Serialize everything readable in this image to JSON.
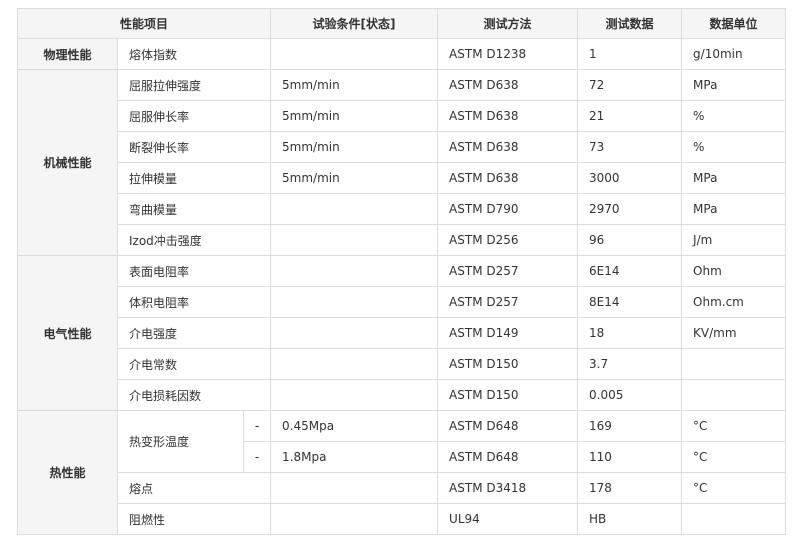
{
  "headers": [
    "性能项目",
    "试验条件[状态]",
    "测试方法",
    "测试数据",
    "数据单位"
  ],
  "groups": [
    {
      "category": "物理性能",
      "rows": [
        {
          "item": "熔体指数",
          "cond": "",
          "method": "ASTM D1238",
          "value": "1",
          "unit": "g/10min"
        }
      ]
    },
    {
      "category": "机械性能",
      "rows": [
        {
          "item": "屈服拉伸强度",
          "cond": "5mm/min",
          "method": "ASTM D638",
          "value": "72",
          "unit": "MPa"
        },
        {
          "item": "屈服伸长率",
          "cond": "5mm/min",
          "method": "ASTM D638",
          "value": "21",
          "unit": "%"
        },
        {
          "item": "断裂伸长率",
          "cond": "5mm/min",
          "method": "ASTM D638",
          "value": "73",
          "unit": "%"
        },
        {
          "item": "拉伸模量",
          "cond": "5mm/min",
          "method": "ASTM D638",
          "value": "3000",
          "unit": "MPa"
        },
        {
          "item": "弯曲模量",
          "cond": "",
          "method": "ASTM D790",
          "value": "2970",
          "unit": "MPa"
        },
        {
          "item": "Izod冲击强度",
          "cond": "",
          "method": "ASTM D256",
          "value": "96",
          "unit": "J/m"
        }
      ]
    },
    {
      "category": "电气性能",
      "rows": [
        {
          "item": "表面电阻率",
          "cond": "",
          "method": "ASTM D257",
          "value": "6E14",
          "unit": "Ohm"
        },
        {
          "item": "体积电阻率",
          "cond": "",
          "method": "ASTM D257",
          "value": "8E14",
          "unit": "Ohm.cm"
        },
        {
          "item": "介电强度",
          "cond": "",
          "method": "ASTM D149",
          "value": "18",
          "unit": "KV/mm"
        },
        {
          "item": "介电常数",
          "cond": "",
          "method": "ASTM D150",
          "value": "3.7",
          "unit": ""
        },
        {
          "item": "介电损耗因数",
          "cond": "",
          "method": "ASTM D150",
          "value": "0.005",
          "unit": ""
        }
      ]
    },
    {
      "category": "热性能",
      "hdt": {
        "item": "热变形温度",
        "rows": [
          {
            "dash": "-",
            "cond": "0.45Mpa",
            "method": "ASTM D648",
            "value": "169",
            "unit": "°C"
          },
          {
            "dash": "-",
            "cond": "1.8Mpa",
            "method": "ASTM D648",
            "value": "110",
            "unit": "°C"
          }
        ]
      },
      "rows": [
        {
          "item": "熔点",
          "cond": "",
          "method": "ASTM D3418",
          "value": "178",
          "unit": "°C"
        },
        {
          "item": "阻燃性",
          "cond": "",
          "method": "UL94",
          "value": "HB",
          "unit": ""
        }
      ]
    }
  ]
}
